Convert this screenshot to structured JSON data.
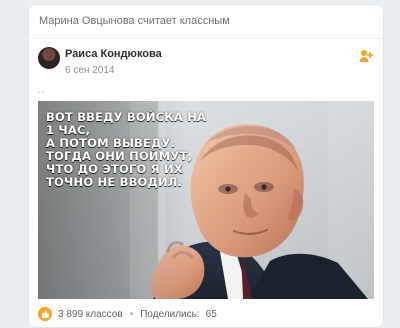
{
  "activity": {
    "text": "Марина Овцынова считает классным"
  },
  "post": {
    "author": "Раиса Кондюкова",
    "date": "6 сен 2014",
    "text_dots": "..",
    "image_caption": "ВОТ ВВЕДУ ВОЙСКА НА 1 ЧАС,\nА ПОТОМ ВЫВЕДУ.\nТОГДА ОНИ ПОЙМУТ,\nЧТО ДО ЭТОГО Я ИХ\nТОЧНО НЕ ВВОДИЛ."
  },
  "footer": {
    "likes": "3 899 классов",
    "dot": "•",
    "share_label": "Поделились:",
    "share_count": "65"
  },
  "icons": {
    "add_friend": "add-friend-icon",
    "like": "class-like-icon"
  },
  "colors": {
    "accent": "#f5a623",
    "text_primary": "#2b2d30",
    "text_secondary": "#6b6f75"
  }
}
